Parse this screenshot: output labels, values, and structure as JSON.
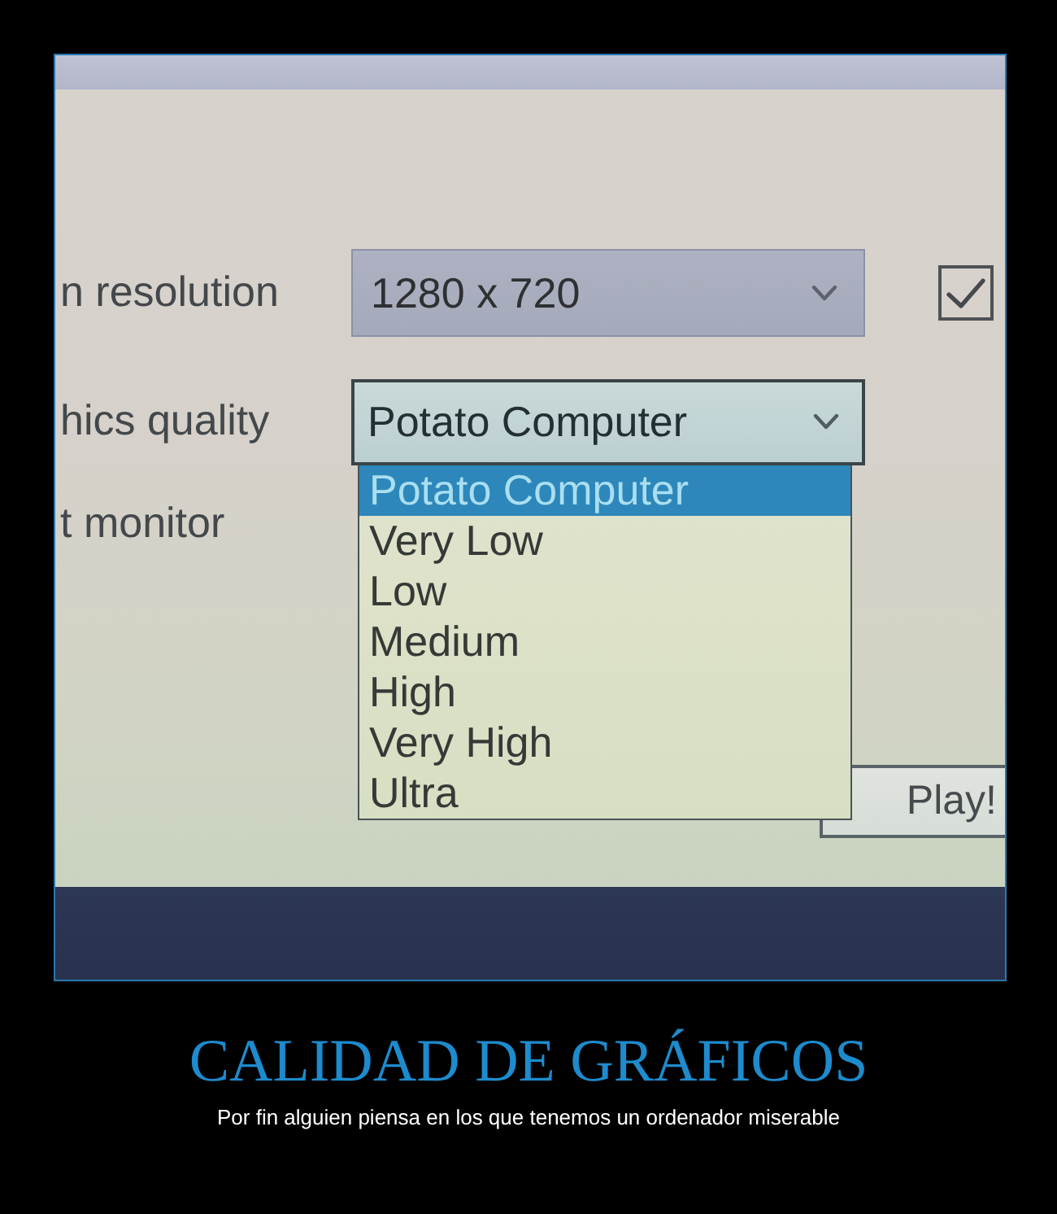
{
  "photo": {
    "window": {
      "rows": [
        {
          "kind": "dropdown",
          "label": "n resolution",
          "value": "1280 x 720",
          "expanded": false,
          "checkbox": {
            "checked": true
          }
        },
        {
          "kind": "dropdown",
          "label": "hics quality",
          "value": "Potato Computer",
          "expanded": true,
          "options": [
            {
              "label": "Potato Computer",
              "selected": true
            },
            {
              "label": "Very Low",
              "selected": false
            },
            {
              "label": "Low",
              "selected": false
            },
            {
              "label": "Medium",
              "selected": false
            },
            {
              "label": "High",
              "selected": false
            },
            {
              "label": "Very High",
              "selected": false
            },
            {
              "label": "Ultra",
              "selected": false
            }
          ]
        },
        {
          "kind": "label",
          "label": "t monitor"
        }
      ],
      "buttons": [
        {
          "label": "Play!"
        }
      ]
    }
  },
  "title": "CALIDAD DE GRÁFICOS",
  "caption": "Por fin alguien piensa en los que tenemos un ordenador miserable"
}
